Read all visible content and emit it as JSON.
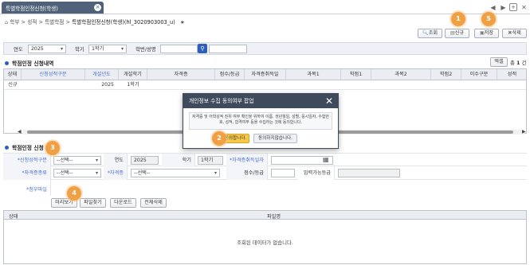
{
  "tab": {
    "title": "특별학점인정신청(학생)"
  },
  "breadcrumb": {
    "home": "학부",
    "sep": ">",
    "level1": "성적",
    "level2": "특별학점",
    "page": "특별학점인정신청(학생)(hl_3020903003_u)"
  },
  "toolbar": {
    "search_label": "조회",
    "new_label": "신규",
    "save_label": "저장",
    "delete_label": "삭제"
  },
  "badges": {
    "b1": "1",
    "b2": "2",
    "b3": "3",
    "b4": "4",
    "b5": "5"
  },
  "search": {
    "year_label": "연도",
    "year_value": "2025",
    "term_label": "학기",
    "term_value": "1학기",
    "student_label": "학번/성명",
    "student_value": ""
  },
  "list_section": {
    "title": "학점인정 신청내역",
    "excel_label": "엑셀",
    "count_prefix": "총",
    "count_value": "1",
    "count_suffix": "건"
  },
  "grid": {
    "columns": [
      "상태",
      "신청성적구분",
      "개설년도",
      "개설학기",
      "자격증",
      "점수/등급",
      "자격증취득일",
      "과목1",
      "학점1",
      "과목2",
      "학점2",
      "이수구분",
      "성적"
    ],
    "rows": [
      {
        "status": "신규",
        "type": "",
        "year": "2025",
        "term": "1학기",
        "cert": "",
        "score": "",
        "date": "",
        "subj1": "",
        "cred1": "",
        "subj2": "",
        "cred2": "",
        "cat": "",
        "grade": ""
      }
    ]
  },
  "apply_section": {
    "title": "학점인정 신청",
    "type_label": "신청성적구분",
    "type_value": "--선택--",
    "year_label": "연도",
    "year_value": "2025",
    "term_label": "학기",
    "term_value": "1학기",
    "date_label": "자격증취득일자",
    "date_value": "",
    "cert_kind_label": "자격증종류",
    "cert_kind_value": "--선택--",
    "cert_label": "자격증",
    "cert_value": "--선택--",
    "score_label": "점수/등급",
    "score_value": "",
    "possible_label": "입력가능등급",
    "possible_value": "",
    "attach_label": "첨부파일",
    "preview_label": "미리보기",
    "find_label": "파일찾기",
    "download_label": "다운로드",
    "delete_all_label": "전체삭제"
  },
  "file_table": {
    "status_header": "상태",
    "name_header": "파일명",
    "empty_message": "조회된 데이터가 없습니다."
  },
  "popup": {
    "title": "개인정보 수집 동의여부 팝업",
    "message": "자격증 및 어학성적 진위 여부 확인을 위하여 이름, 생년월일, 성별, 응시일자, 수험번호, 성적, 합격여부 등을 수집하는 것에 동의합니다.",
    "agree_label": "동의합니다.",
    "disagree_label": "동의하지않습니다."
  },
  "colors": {
    "accent": "#f0a044",
    "header": "#4f6279",
    "popup_header": "#3f4a5c",
    "required": "#4a6fd1"
  }
}
